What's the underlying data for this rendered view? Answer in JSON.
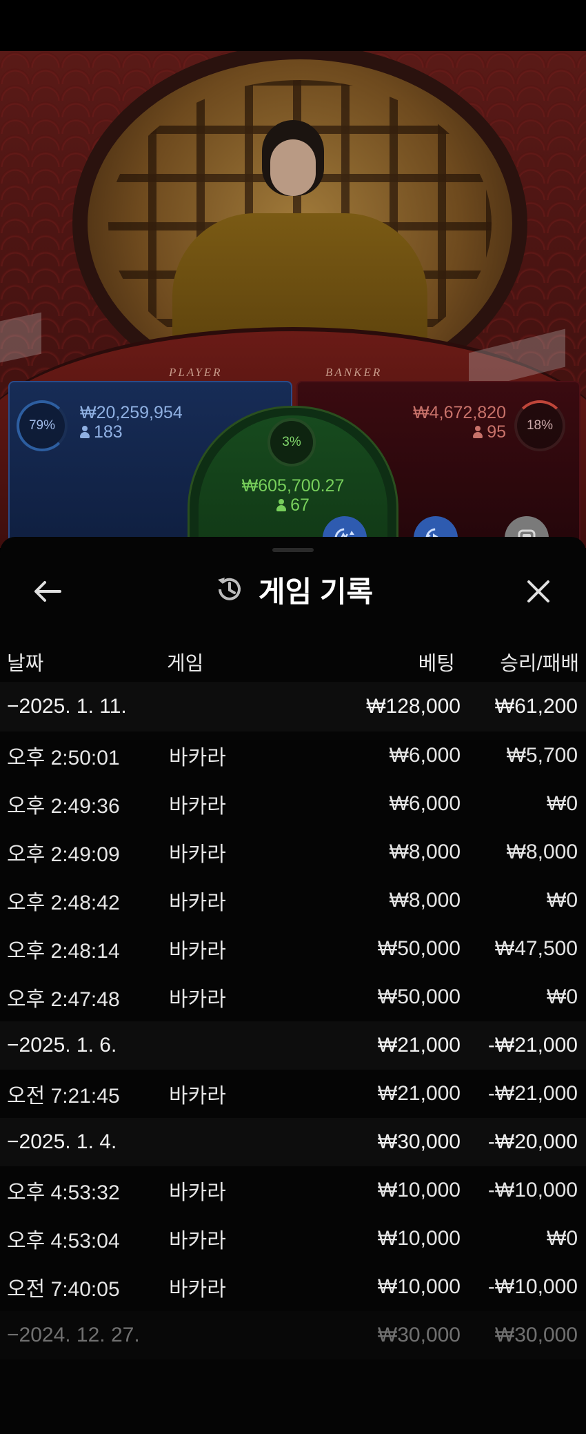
{
  "stream": {
    "table_labels": {
      "player": "PLAYER",
      "banker": "BANKER"
    }
  },
  "bets": {
    "player": {
      "percent": "79%",
      "amount": "₩20,259,954",
      "players": "183"
    },
    "tie": {
      "percent": "3%",
      "amount": "₩605,700.27",
      "players": "67"
    },
    "banker": {
      "percent": "18%",
      "amount": "₩4,672,820",
      "players": "95"
    }
  },
  "actions": [
    {
      "icon": "repeat-icon"
    },
    {
      "icon": "autoplay-icon"
    },
    {
      "icon": "stop-icon"
    }
  ],
  "sheet": {
    "title": "게임 기록",
    "columns": {
      "date": "날짜",
      "game": "게임",
      "bet": "베팅",
      "winloss": "승리/패배"
    }
  },
  "rows": [
    {
      "type": "date",
      "date": "−2025. 1. 11.",
      "bet": "₩128,000",
      "winloss": "₩61,200"
    },
    {
      "type": "item",
      "date": "오후 2:50:01",
      "game": "바카라",
      "bet": "₩6,000",
      "winloss": "₩5,700"
    },
    {
      "type": "item",
      "date": "오후 2:49:36",
      "game": "바카라",
      "bet": "₩6,000",
      "winloss": "₩0"
    },
    {
      "type": "item",
      "date": "오후 2:49:09",
      "game": "바카라",
      "bet": "₩8,000",
      "winloss": "₩8,000"
    },
    {
      "type": "item",
      "date": "오후 2:48:42",
      "game": "바카라",
      "bet": "₩8,000",
      "winloss": "₩0"
    },
    {
      "type": "item",
      "date": "오후 2:48:14",
      "game": "바카라",
      "bet": "₩50,000",
      "winloss": "₩47,500"
    },
    {
      "type": "item",
      "date": "오후 2:47:48",
      "game": "바카라",
      "bet": "₩50,000",
      "winloss": "₩0"
    },
    {
      "type": "date",
      "date": "−2025. 1. 6.",
      "bet": "₩21,000",
      "winloss": "-₩21,000"
    },
    {
      "type": "item",
      "date": "오전 7:21:45",
      "game": "바카라",
      "bet": "₩21,000",
      "winloss": "-₩21,000"
    },
    {
      "type": "date",
      "date": "−2025. 1. 4.",
      "bet": "₩30,000",
      "winloss": "-₩20,000"
    },
    {
      "type": "item",
      "date": "오후 4:53:32",
      "game": "바카라",
      "bet": "₩10,000",
      "winloss": "-₩10,000"
    },
    {
      "type": "item",
      "date": "오후 4:53:04",
      "game": "바카라",
      "bet": "₩10,000",
      "winloss": "₩0"
    },
    {
      "type": "item",
      "date": "오전 7:40:05",
      "game": "바카라",
      "bet": "₩10,000",
      "winloss": "-₩10,000"
    },
    {
      "type": "date",
      "date": "−2024. 12. 27.",
      "bet": "₩30,000",
      "winloss": "₩30,000",
      "faded": true
    }
  ]
}
